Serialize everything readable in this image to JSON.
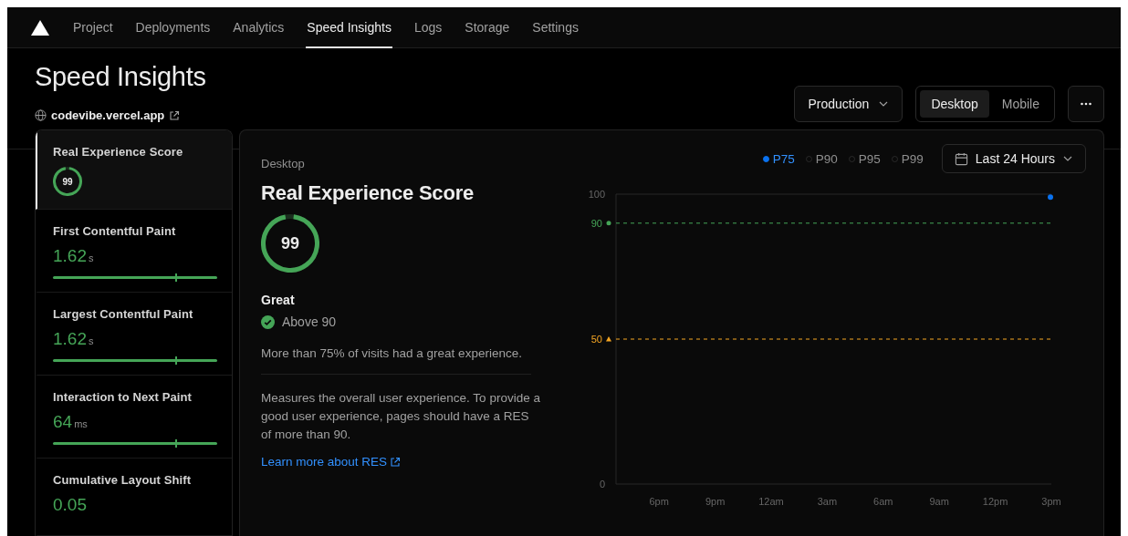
{
  "nav": {
    "tabs": [
      {
        "label": "Project",
        "selected": false
      },
      {
        "label": "Deployments",
        "selected": false
      },
      {
        "label": "Analytics",
        "selected": false
      },
      {
        "label": "Speed Insights",
        "selected": true
      },
      {
        "label": "Logs",
        "selected": false
      },
      {
        "label": "Storage",
        "selected": false
      },
      {
        "label": "Settings",
        "selected": false
      }
    ]
  },
  "header": {
    "title": "Speed Insights",
    "site": "codevibe.vercel.app",
    "environment": "Production",
    "devices": [
      {
        "label": "Desktop",
        "selected": true
      },
      {
        "label": "Mobile",
        "selected": false
      }
    ]
  },
  "sidebar": {
    "items": [
      {
        "kind": "score",
        "title": "Real Experience Score",
        "value": "99",
        "level": 0.99,
        "selected": true
      },
      {
        "kind": "metric",
        "title": "First Contentful Paint",
        "value": "1.62",
        "unit": "s",
        "level": 0.75,
        "selected": false
      },
      {
        "kind": "metric",
        "title": "Largest Contentful Paint",
        "value": "1.62",
        "unit": "s",
        "level": 0.75,
        "selected": false
      },
      {
        "kind": "metric",
        "title": "Interaction to Next Paint",
        "value": "64",
        "unit": "ms",
        "level": 0.75,
        "selected": false
      },
      {
        "kind": "metric",
        "title": "Cumulative Layout Shift",
        "value": "0.05",
        "selected": false
      }
    ]
  },
  "detail": {
    "device": "Desktop",
    "title": "Real Experience Score",
    "score": "99",
    "level": 0.99,
    "rating": "Great",
    "status": "Above 90",
    "summary": "More than 75% of visits had a great experience.",
    "description": "Measures the overall user experience. To provide a good user experience, pages should have a RES of more than 90.",
    "link": "Learn more about RES",
    "percentiles": [
      {
        "label": "P75",
        "selected": true
      },
      {
        "label": "P90",
        "selected": false
      },
      {
        "label": "P95",
        "selected": false
      },
      {
        "label": "P99",
        "selected": false
      }
    ],
    "range": "Last 24 Hours",
    "chart_data": {
      "type": "scatter",
      "x": [
        "6pm",
        "9pm",
        "12am",
        "3am",
        "6am",
        "9am",
        "12pm",
        "3pm"
      ],
      "series": [
        {
          "color": "#0a72ef",
          "values": [
            null,
            null,
            null,
            null,
            null,
            null,
            null,
            99
          ]
        }
      ],
      "ylim": [
        0,
        100
      ],
      "yticks": [
        0,
        50,
        90,
        100
      ],
      "ref_lines": [
        {
          "axis": "y",
          "value": 90,
          "color": "#45a557"
        },
        {
          "axis": "y",
          "value": 50,
          "color": "#f5a623"
        }
      ]
    }
  }
}
